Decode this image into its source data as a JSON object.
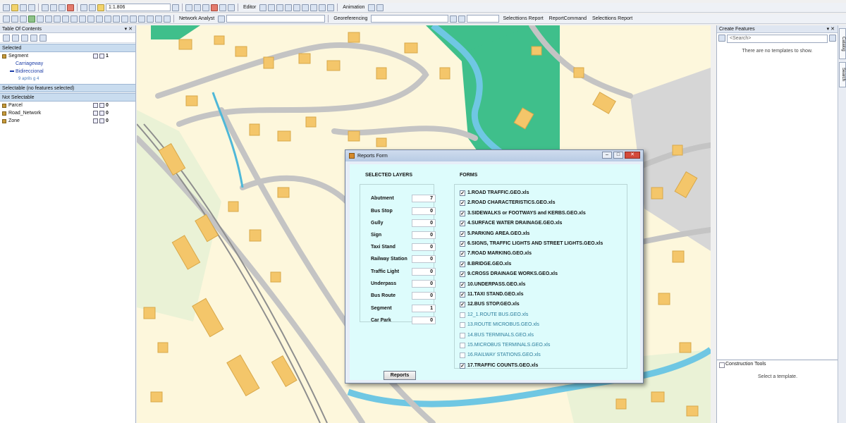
{
  "toolbar1": {
    "scale": "1:1.806",
    "editor": "Editor",
    "animation": "Animation"
  },
  "toolbar2": {
    "network_analyst": "Network Analyst",
    "georeferencing": "Georeferencing",
    "selections_report": "Selecttions Report",
    "report_command": "ReportCommand",
    "selections_report2": "Selecttions Report"
  },
  "toc": {
    "title": "Table Of Contents",
    "selected_group": "Selected",
    "selected_layer": {
      "name": "Segment",
      "count": "1"
    },
    "legend_items": [
      "Carriageway",
      "Bidireccional"
    ],
    "legend_note": "9 aprils g 4",
    "selectable_group": "Selectable (no features selected)",
    "not_selectable_group": "Not Selectable",
    "not_selectable_layers": [
      {
        "name": "Parcel",
        "count": "0"
      },
      {
        "name": "Road_Network",
        "count": "0"
      },
      {
        "name": "Zone",
        "count": "0"
      }
    ]
  },
  "create_features": {
    "title": "Create Features",
    "search_placeholder": "<Search>",
    "no_templates": "There are no templates to show.",
    "construction_tools": "Construction Tools",
    "select_template": "Select a template."
  },
  "side_tabs": [
    "Catalog",
    "Search"
  ],
  "dialog": {
    "title": "Reports Form",
    "selected_layers_heading": "SELECTED LAYERS",
    "forms_heading": "FORMS",
    "layers": [
      {
        "label": "Abutment",
        "value": "7"
      },
      {
        "label": "Bus Stop",
        "value": "0"
      },
      {
        "label": "Gully",
        "value": "0"
      },
      {
        "label": "Sign",
        "value": "0"
      },
      {
        "label": "Taxi Stand",
        "value": "0"
      },
      {
        "label": "Railway Station",
        "value": "0"
      },
      {
        "label": "Traffic Light",
        "value": "0"
      },
      {
        "label": "Underpass",
        "value": "0"
      },
      {
        "label": "Bus Route",
        "value": "0"
      },
      {
        "label": "Segment",
        "value": "1"
      },
      {
        "label": "Car Park",
        "value": "0"
      }
    ],
    "forms": [
      {
        "label": "1.ROAD TRAFFIC.GEO.xls",
        "checked": true
      },
      {
        "label": "2.ROAD CHARACTERISTICS.GEO.xls",
        "checked": true
      },
      {
        "label": "3.SIDEWALKS or FOOTWAYS and KERBS.GEO.xls",
        "checked": true
      },
      {
        "label": "4.SURFACE WATER DRAINAGE.GEO.xls",
        "checked": true
      },
      {
        "label": "5.PARKING AREA.GEO.xls",
        "checked": true
      },
      {
        "label": "6.SIGNS, TRAFFIC LIGHTS AND STREET LIGHTS.GEO.xls",
        "checked": true
      },
      {
        "label": "7.ROAD MARKING.GEO.xls",
        "checked": true
      },
      {
        "label": "8.BRIDGE.GEO.xls",
        "checked": true
      },
      {
        "label": "9.CROSS DRAINAGE WORKS.GEO.xls",
        "checked": true
      },
      {
        "label": "10.UNDERPASS.GEO.xls",
        "checked": true
      },
      {
        "label": "11.TAXI STAND.GEO.xls",
        "checked": true
      },
      {
        "label": "12.BUS STOP.GEO.xls",
        "checked": true
      },
      {
        "label": "12_1.ROUTE BUS.GEO.xls",
        "checked": false
      },
      {
        "label": "13.ROUTE MICROBUS.GEO.xls",
        "checked": false
      },
      {
        "label": "14.BUS TERMINALS.GEO.xls",
        "checked": false
      },
      {
        "label": "15.MICROBUS TERMINALS.GEO.xls",
        "checked": false
      },
      {
        "label": "16.RAILWAY STATIONS.GEO.xls",
        "checked": false
      },
      {
        "label": "17.TRAFFIC COUNTS.GEO.xls",
        "checked": true
      }
    ],
    "reports_button": "Reports"
  },
  "colors": {
    "map_background": "#fdf7dc",
    "building": "#f4c66a",
    "road": "#bdbdbd",
    "green_area": "#3fbf8b",
    "river": "#6fc7e3",
    "dialog_client": "#ddfcfc"
  }
}
